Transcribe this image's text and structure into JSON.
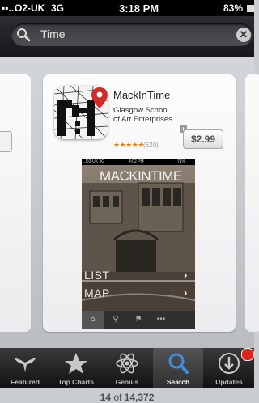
{
  "status_bar": {
    "signal": "▪▪...",
    "carrier": "O2-UK",
    "network": "3G",
    "time": "3:18 PM",
    "battery": "83%"
  },
  "search": {
    "query": "Time"
  },
  "app": {
    "name": "MackInTime",
    "developer": "Glasgow School of Art Enterprises",
    "stars": "★★★★★",
    "rating_count": "(620)",
    "price": "$2.99",
    "rating_value": 5
  },
  "screenshot": {
    "carrier": "..O2-UK 3G",
    "time": "4:02 PM",
    "battery": "71%",
    "title": "MACKINTIME",
    "menu": [
      "LIST",
      "MAP"
    ]
  },
  "pager": {
    "current": "14",
    "of": "of",
    "total": "14,372"
  },
  "tabs": [
    {
      "label": "Featured",
      "icon": "featured-icon"
    },
    {
      "label": "Top Charts",
      "icon": "star-icon"
    },
    {
      "label": "Genius",
      "icon": "atom-icon"
    },
    {
      "label": "Search",
      "icon": "search-icon"
    },
    {
      "label": "Updates",
      "icon": "download-icon"
    }
  ],
  "colors": {
    "price_text": "#555555",
    "stars": "#e07d14",
    "badge": "#e0221a",
    "search_accent": "#3d8ee0"
  }
}
